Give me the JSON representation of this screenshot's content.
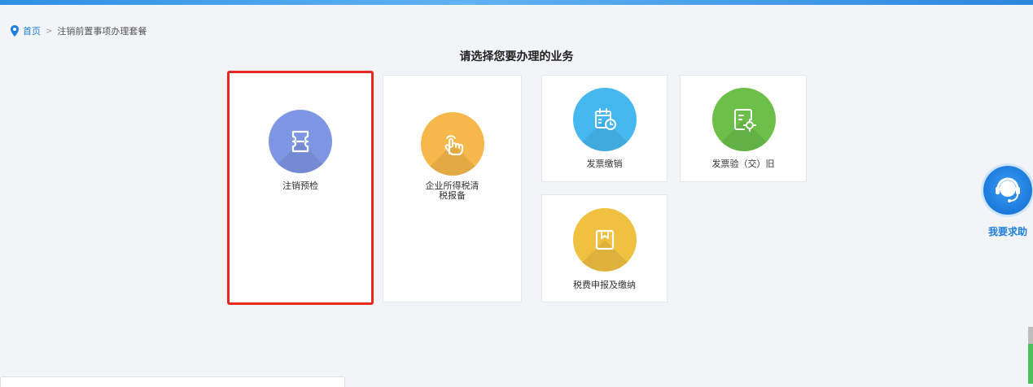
{
  "breadcrumb": {
    "home": "首页",
    "separator": ">",
    "current": "注销前置事项办理套餐"
  },
  "page_title": "请选择您要办理的业务",
  "cards": [
    {
      "label": "注销预检",
      "icon": "ticket-icon",
      "color": "#7e96e4",
      "selected": true
    },
    {
      "label_line1": "企业所得税清",
      "label_line2": "税报备",
      "icon": "hand-pointer-icon",
      "color": "#f7b84b"
    },
    {
      "label": "发票缴销",
      "icon": "calendar-clock-icon",
      "color": "#46b8f0"
    },
    {
      "label": "发票验（交）旧",
      "icon": "document-gear-icon",
      "color": "#6cc04a"
    },
    {
      "label": "税费申报及缴纳",
      "icon": "book-icon",
      "color": "#f0c040"
    }
  ],
  "help": {
    "label": "我要求助",
    "icon": "headset-icon"
  },
  "colors": {
    "accent": "#1e7fe0",
    "selection": "#e8281e",
    "background": "#f2f4f7"
  }
}
